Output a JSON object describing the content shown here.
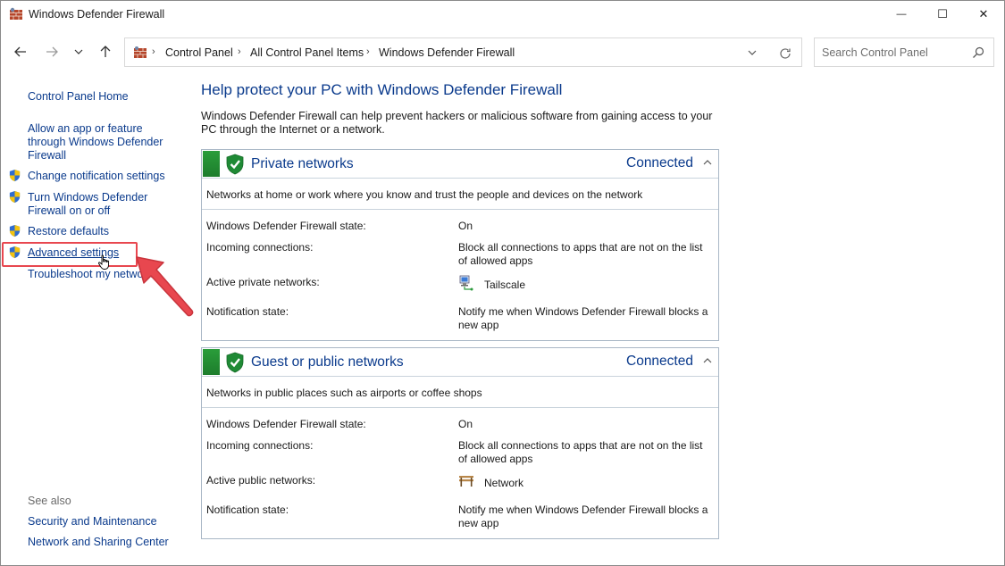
{
  "window": {
    "title": "Windows Defender Firewall",
    "controls": {
      "minimize": "—",
      "maximize": "☐",
      "close": "✕"
    }
  },
  "nav": {
    "breadcrumbs": [
      "Control Panel",
      "All Control Panel Items",
      "Windows Defender Firewall"
    ],
    "search_placeholder": "Search Control Panel"
  },
  "sidebar": {
    "home": "Control Panel Home",
    "links": [
      {
        "label": "Allow an app or feature through Windows Defender Firewall",
        "shield": false
      },
      {
        "label": "Change notification settings",
        "shield": true
      },
      {
        "label": "Turn Windows Defender Firewall on or off",
        "shield": true
      },
      {
        "label": "Restore defaults",
        "shield": true
      },
      {
        "label": "Advanced settings",
        "shield": true,
        "highlighted": true
      },
      {
        "label": "Troubleshoot my network",
        "shield": false
      }
    ],
    "see_also_label": "See also",
    "see_also": [
      "Security and Maintenance",
      "Network and Sharing Center"
    ]
  },
  "main": {
    "title": "Help protect your PC with Windows Defender Firewall",
    "description": "Windows Defender Firewall can help prevent hackers or malicious software from gaining access to your PC through the Internet or a network.",
    "panels": [
      {
        "title": "Private networks",
        "status": "Connected",
        "description": "Networks at home or work where you know and trust the people and devices on the network",
        "rows": {
          "state_label": "Windows Defender Firewall state:",
          "state_value": "On",
          "incoming_label": "Incoming connections:",
          "incoming_value": "Block all connections to apps that are not on the list of allowed apps",
          "active_label": "Active private networks:",
          "active_value": "Tailscale",
          "notify_label": "Notification state:",
          "notify_value": "Notify me when Windows Defender Firewall blocks a new app"
        }
      },
      {
        "title": "Guest or public networks",
        "status": "Connected",
        "description": "Networks in public places such as airports or coffee shops",
        "rows": {
          "state_label": "Windows Defender Firewall state:",
          "state_value": "On",
          "incoming_label": "Incoming connections:",
          "incoming_value": "Block all connections to apps that are not on the list of allowed apps",
          "active_label": "Active public networks:",
          "active_value": "Network",
          "notify_label": "Notification state:",
          "notify_value": "Notify me when Windows Defender Firewall blocks a new app"
        }
      }
    ]
  },
  "colors": {
    "link": "#0a3a8c",
    "highlight": "#e8474f",
    "panel_green": "#1d7d2c"
  },
  "icons": {
    "app": "firewall-icon",
    "shield": "uac-shield-icon",
    "panel_shield": "green-check-shield-icon",
    "private_network": "network-computer-icon",
    "public_network": "bench-icon"
  }
}
